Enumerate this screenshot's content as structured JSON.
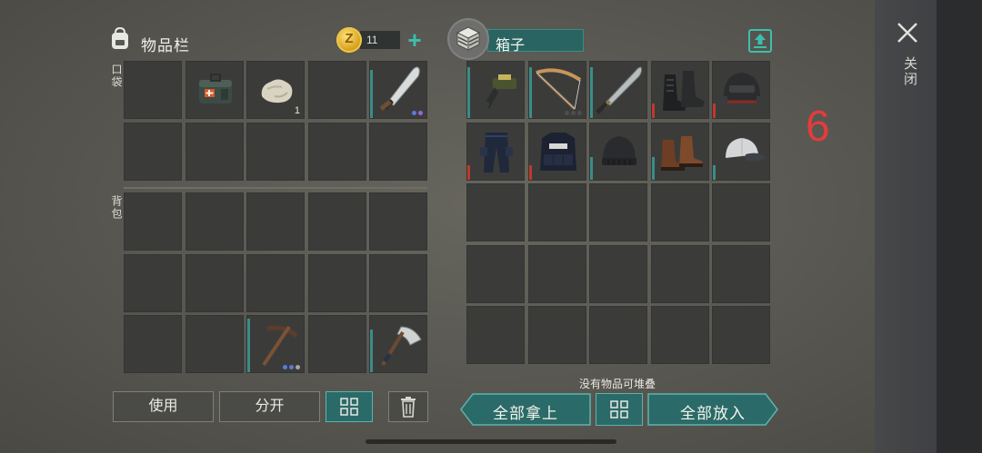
{
  "inventory": {
    "title": "物品栏",
    "currency": {
      "icon": "z-coin-icon",
      "amount": "11",
      "add_label": "+"
    },
    "pocket_label": "口袋",
    "backpack_label": "背包",
    "pocket_items": [
      {
        "icon": "",
        "count": "",
        "durability": 0,
        "dots": []
      },
      {
        "icon": "medkit-bag-icon",
        "count": "",
        "durability": 0,
        "dots": []
      },
      {
        "icon": "stone-icon",
        "count": "1",
        "durability": 0,
        "dots": []
      },
      {
        "icon": "",
        "count": "",
        "durability": 0,
        "dots": []
      },
      {
        "icon": "machete-icon",
        "count": "",
        "durability": 0.85,
        "dots": [
          "#5a7bd8",
          "#9a64d8"
        ]
      },
      {
        "icon": "",
        "count": "",
        "durability": 0,
        "dots": []
      },
      {
        "icon": "",
        "count": "",
        "durability": 0,
        "dots": []
      },
      {
        "icon": "",
        "count": "",
        "durability": 0,
        "dots": []
      },
      {
        "icon": "",
        "count": "",
        "durability": 0,
        "dots": []
      },
      {
        "icon": "",
        "count": "",
        "durability": 0,
        "dots": []
      }
    ],
    "backpack_items": [
      {
        "icon": "",
        "count": "",
        "durability": 0,
        "dots": []
      },
      {
        "icon": "",
        "count": "",
        "durability": 0,
        "dots": []
      },
      {
        "icon": "",
        "count": "",
        "durability": 0,
        "dots": []
      },
      {
        "icon": "",
        "count": "",
        "durability": 0,
        "dots": []
      },
      {
        "icon": "",
        "count": "",
        "durability": 0,
        "dots": []
      },
      {
        "icon": "",
        "count": "",
        "durability": 0,
        "dots": []
      },
      {
        "icon": "",
        "count": "",
        "durability": 0,
        "dots": []
      },
      {
        "icon": "",
        "count": "",
        "durability": 0,
        "dots": []
      },
      {
        "icon": "",
        "count": "",
        "durability": 0,
        "dots": []
      },
      {
        "icon": "",
        "count": "",
        "durability": 0,
        "dots": []
      },
      {
        "icon": "",
        "count": "",
        "durability": 0,
        "dots": []
      },
      {
        "icon": "",
        "count": "",
        "durability": 0,
        "dots": []
      },
      {
        "icon": "pickaxe-icon",
        "count": "",
        "durability": 0.95,
        "dots": [
          "#5a7bd8",
          "#5a7bd8",
          "#a8a8a0"
        ]
      },
      {
        "icon": "",
        "count": "",
        "durability": 0,
        "dots": []
      },
      {
        "icon": "hatchet-icon",
        "count": "",
        "durability": 0.75,
        "dots": []
      }
    ],
    "buttons": {
      "use": "使用",
      "split": "分开",
      "sort_icon": "grid-sort-icon",
      "delete_icon": "trash-icon"
    }
  },
  "box": {
    "icon": "box-crate-icon",
    "title": "箱子",
    "upload_icon": "upload-icon",
    "items": [
      {
        "icon": "nailgun-icon",
        "durability": 0.9,
        "dur_color": "#3a8d88"
      },
      {
        "icon": "crossbow-icon",
        "durability": 0.9,
        "dur_color": "#3a8d88",
        "dots": [
          "#4e4e4a",
          "#4e4e4a",
          "#4e4e4a"
        ]
      },
      {
        "icon": "katana-icon",
        "durability": 0.9,
        "dur_color": "#3a8d88"
      },
      {
        "icon": "combat-boots-icon",
        "durability": 0.25,
        "dur_color": "#c0392b"
      },
      {
        "icon": "tactical-helmet-icon",
        "durability": 0.25,
        "dur_color": "#c0392b"
      },
      {
        "icon": "police-pants-icon",
        "durability": 0.25,
        "dur_color": "#c0392b"
      },
      {
        "icon": "police-vest-icon",
        "durability": 0.25,
        "dur_color": "#c0392b"
      },
      {
        "icon": "beanie-icon",
        "durability": 0.4,
        "dur_color": "#3a8d88"
      },
      {
        "icon": "brown-boots-icon",
        "durability": 0.4,
        "dur_color": "#3a8d88"
      },
      {
        "icon": "baseball-cap-icon",
        "durability": 0.25,
        "dur_color": "#3a8d88"
      }
    ],
    "note": "没有物品可堆叠",
    "take_all": "全部拿上",
    "put_all": "全部放入",
    "sort_icon": "grid-sort-icon"
  },
  "close": {
    "icon": "close-icon",
    "label": "关闭"
  },
  "overlay_number": "6"
}
